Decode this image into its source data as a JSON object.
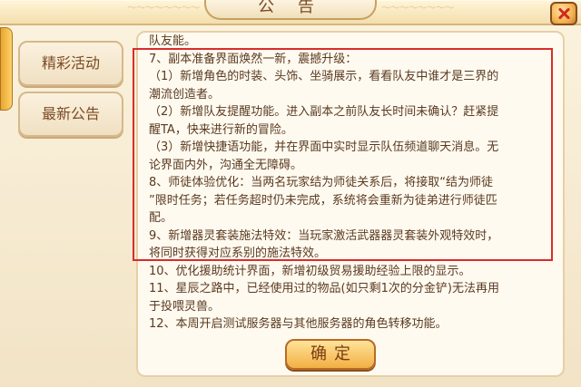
{
  "window": {
    "title": "公 告",
    "close_icon": "close-icon"
  },
  "sidebar": {
    "tabs": [
      {
        "label": "精彩活动"
      },
      {
        "label": "最新公告"
      }
    ]
  },
  "content": {
    "lines": [
      "队友能。",
      "7、副本准备界面焕然一新，震撼升级：",
      "（1）新增角色的时装、头饰、坐骑展示，看看队友中谁才是三界的",
      "潮流创造者。",
      "（2）新增队友提醒功能。进入副本之前队友长时间未确认？赶紧提",
      "醒TA，快来进行新的冒险。",
      "（3）新增快捷语功能，并在界面中实时显示队伍频道聊天消息。无",
      "论界面内外，沟通全无障碍。",
      "8、师徒体验优化：当两名玩家结为师徒关系后，将接取“结为师徒",
      "”限时任务；若任务超时仍未完成，系统将会重新为徒弟进行师徒匹",
      "配。",
      "9、新增器灵套装施法特效：当玩家激活武器器灵套装外观特效时，",
      "将同时获得对应系别的施法特效。",
      "10、优化援助统计界面，新增初级贸易援助经验上限的显示。",
      "11、星辰之路中，已经使用过的物品(如只剩1次的分金铲)无法再用",
      "于投喂灵兽。",
      "12、本周开启测试服务器与其他服务器的角色转移功能。"
    ]
  },
  "footer": {
    "confirm_label": "确定"
  },
  "colors": {
    "highlight_border": "#d92b2b",
    "text": "#5a3a1f",
    "accent": "#f2b044"
  }
}
